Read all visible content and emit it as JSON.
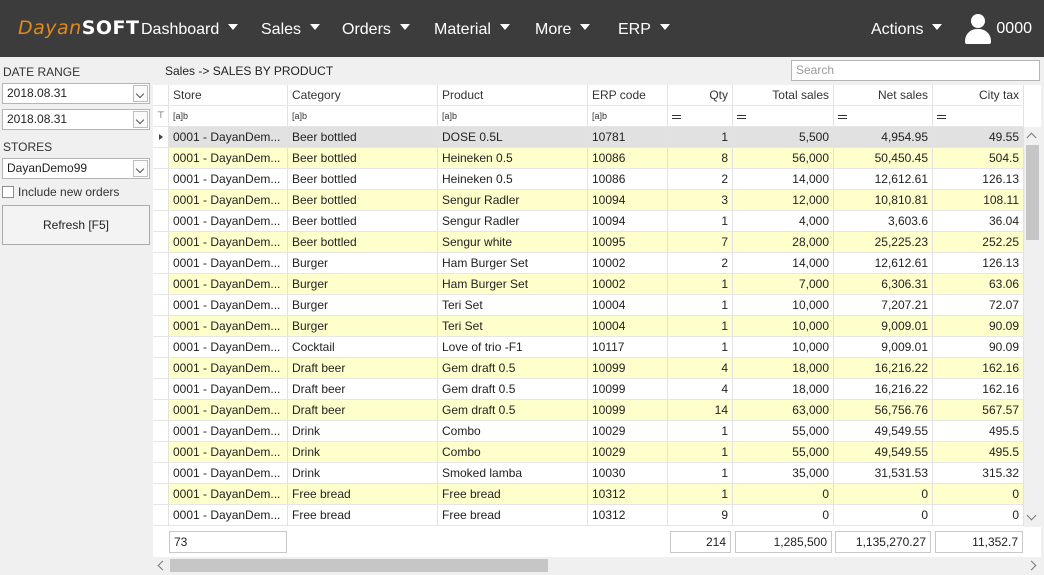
{
  "brand": {
    "part1": "Dayan",
    "part2": "SOFT",
    "accent": "#e08a1e"
  },
  "nav": {
    "items": [
      "Dashboard",
      "Sales",
      "Orders",
      "Material",
      "More",
      "ERP"
    ],
    "actions": "Actions",
    "user": "0000"
  },
  "sidebar": {
    "date_range_label": "DATE RANGE",
    "date_from": "2018.08.31",
    "date_to": "2018.08.31",
    "stores_label": "STORES",
    "store_selected": "DayanDemo99",
    "include_new_orders": "Include new orders",
    "include_new_orders_checked": false,
    "refresh_label": "Refresh [F5]"
  },
  "breadcrumb": "Sales -> SALES BY PRODUCT",
  "search": {
    "placeholder": "Search"
  },
  "table": {
    "columns": [
      "Store",
      "Category",
      "Product",
      "ERP code",
      "Qty",
      "Total sales",
      "Net sales",
      "City tax"
    ],
    "filter_text": "[a]b",
    "rows": [
      [
        "0001 - DayanDem...",
        "Beer bottled",
        "DOSE 0.5L",
        "10781",
        "1",
        "5,500",
        "4,954.95",
        "49.55"
      ],
      [
        "0001 - DayanDem...",
        "Beer bottled",
        "Heineken 0.5",
        "10086",
        "8",
        "56,000",
        "50,450.45",
        "504.5"
      ],
      [
        "0001 - DayanDem...",
        "Beer bottled",
        "Heineken 0.5",
        "10086",
        "2",
        "14,000",
        "12,612.61",
        "126.13"
      ],
      [
        "0001 - DayanDem...",
        "Beer bottled",
        "Sengur Radler",
        "10094",
        "3",
        "12,000",
        "10,810.81",
        "108.11"
      ],
      [
        "0001 - DayanDem...",
        "Beer bottled",
        "Sengur Radler",
        "10094",
        "1",
        "4,000",
        "3,603.6",
        "36.04"
      ],
      [
        "0001 - DayanDem...",
        "Beer bottled",
        "Sengur white",
        "10095",
        "7",
        "28,000",
        "25,225.23",
        "252.25"
      ],
      [
        "0001 - DayanDem...",
        "Burger",
        "Ham Burger Set",
        "10002",
        "2",
        "14,000",
        "12,612.61",
        "126.13"
      ],
      [
        "0001 - DayanDem...",
        "Burger",
        "Ham Burger Set",
        "10002",
        "1",
        "7,000",
        "6,306.31",
        "63.06"
      ],
      [
        "0001 - DayanDem...",
        "Burger",
        "Teri Set",
        "10004",
        "1",
        "10,000",
        "7,207.21",
        "72.07"
      ],
      [
        "0001 - DayanDem...",
        "Burger",
        "Teri Set",
        "10004",
        "1",
        "10,000",
        "9,009.01",
        "90.09"
      ],
      [
        "0001 - DayanDem...",
        "Cocktail",
        "Love of trio -F1",
        "10117",
        "1",
        "10,000",
        "9,009.01",
        "90.09"
      ],
      [
        "0001 - DayanDem...",
        "Draft beer",
        "Gem draft 0.5",
        "10099",
        "4",
        "18,000",
        "16,216.22",
        "162.16"
      ],
      [
        "0001 - DayanDem...",
        "Draft beer",
        "Gem draft 0.5",
        "10099",
        "4",
        "18,000",
        "16,216.22",
        "162.16"
      ],
      [
        "0001 - DayanDem...",
        "Draft beer",
        "Gem draft 0.5",
        "10099",
        "14",
        "63,000",
        "56,756.76",
        "567.57"
      ],
      [
        "0001 - DayanDem...",
        "Drink",
        "Combo",
        "10029",
        "1",
        "55,000",
        "49,549.55",
        "495.5"
      ],
      [
        "0001 - DayanDem...",
        "Drink",
        "Combo",
        "10029",
        "1",
        "55,000",
        "49,549.55",
        "495.5"
      ],
      [
        "0001 - DayanDem...",
        "Drink",
        "Smoked lamba",
        "10030",
        "1",
        "35,000",
        "31,531.53",
        "315.32"
      ],
      [
        "0001 - DayanDem...",
        "Free bread",
        "Free bread",
        "10312",
        "1",
        "0",
        "0",
        "0"
      ],
      [
        "0001 - DayanDem...",
        "Free bread",
        "Free bread",
        "10312",
        "9",
        "0",
        "0",
        "0"
      ]
    ],
    "totals": {
      "store_count": "73",
      "qty": "214",
      "total_sales": "1,285,500",
      "net_sales": "1,135,270.27",
      "city_tax": "11,352.7"
    }
  },
  "colors": {
    "topbar": "#3c3c3c",
    "row_alt": "#ffffcc",
    "row_selected": "#e1e1e1"
  }
}
